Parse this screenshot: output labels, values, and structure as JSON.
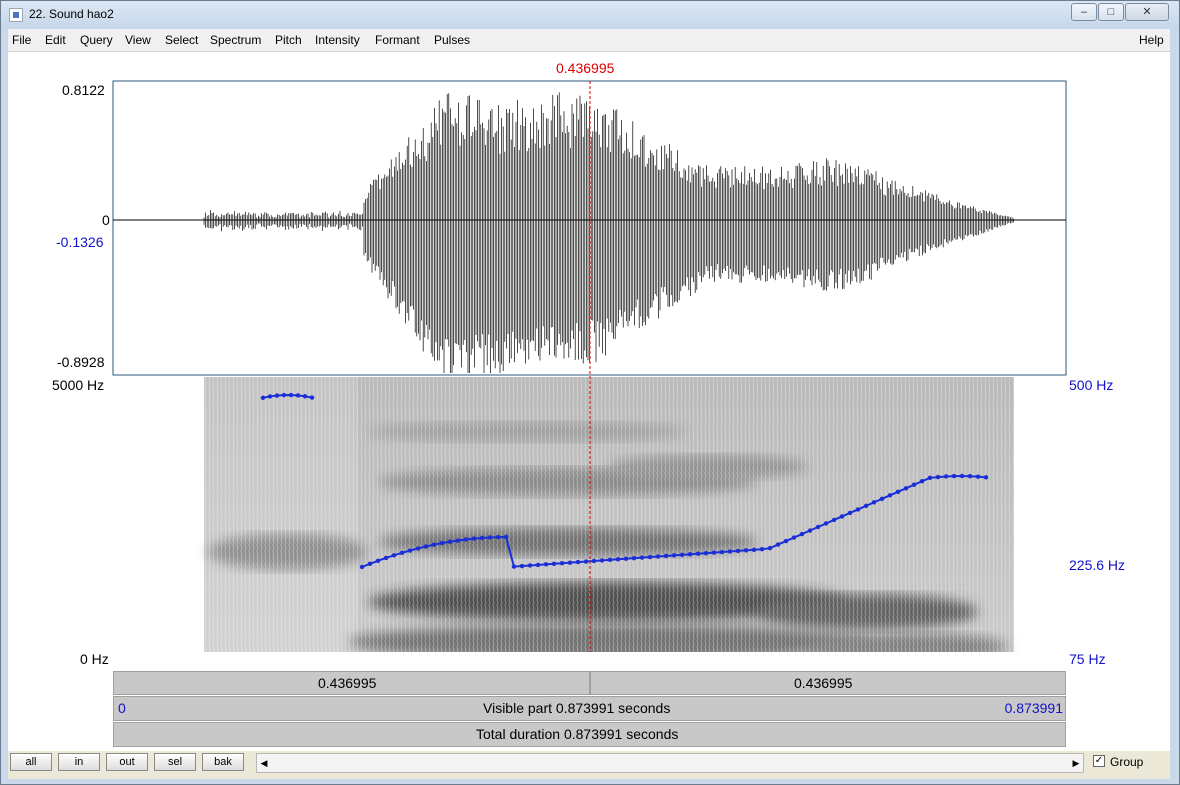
{
  "window": {
    "title": "22. Sound hao2",
    "controls": {
      "minimize": "–",
      "maximize": "□",
      "close": "✕"
    }
  },
  "menu": {
    "items": [
      "File",
      "Edit",
      "Query",
      "View",
      "Select",
      "Spectrum",
      "Pitch",
      "Intensity",
      "Formant",
      "Pulses"
    ],
    "help": "Help"
  },
  "cursor": {
    "time_label": "0.436995"
  },
  "waveform": {
    "y_max": "0.8122",
    "y_zero": "0",
    "y_cursor_value": "-0.1326",
    "y_min": "-0.8928"
  },
  "spectrogram": {
    "freq_max": "5000 Hz",
    "freq_min": "0 Hz",
    "pitch_max": "500 Hz",
    "pitch_mid": "225.6 Hz",
    "pitch_min": "75 Hz"
  },
  "time_bars": {
    "left_segment": "0.436995",
    "right_segment": "0.436995",
    "visible_start": "0",
    "visible_text": "Visible part 0.873991 seconds",
    "visible_end": "0.873991",
    "total_text": "Total duration 0.873991 seconds"
  },
  "bottom_bar": {
    "buttons": [
      "all",
      "in",
      "out",
      "sel",
      "bak"
    ],
    "group_label": "Group",
    "group_checked": "✓"
  },
  "colors": {
    "pitch": "#1a2ed8",
    "cursor": "#e00000",
    "label_blue": "#1212c8"
  }
}
